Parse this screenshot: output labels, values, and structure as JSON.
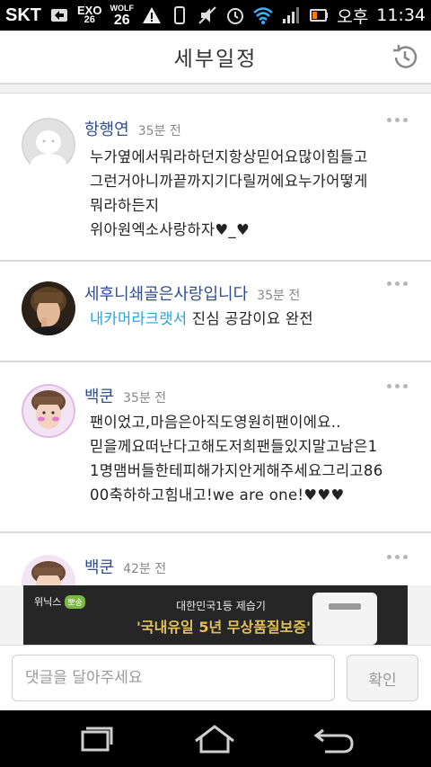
{
  "status_bar": {
    "carrier": "SKT",
    "exo_label": "EXO",
    "exo_num": "26",
    "wolf_label": "WOLF",
    "wolf_num": "26",
    "ampm": "오후",
    "time": "11:34"
  },
  "header": {
    "title": "세부일정",
    "history_icon": "history-icon"
  },
  "comments": [
    {
      "name": "항행연",
      "time": "35분 전",
      "lines": [
        "누가옆에서뭐라하던지항상믿어요많이힘들고",
        "그런거아니까끝까지기다릴꺼에요누가어떻게",
        "뭐라하든지",
        "위아원엑소사랑하자♥_♥"
      ]
    },
    {
      "name": "세후니쇄골은사랑입니다",
      "time": "35분 전",
      "mention": "내카머라크랫서",
      "text": " 진심 공감이요 완전"
    },
    {
      "name": "백쿤",
      "time": "35분 전",
      "lines": [
        "팬이었고,마음은아직도영원히팬이에요..",
        "믿을께요떠난다고해도저희팬들있지말고남은1",
        "1명맴버들한테피해가지안게해주세요그리고86",
        "00축하하고힘내고!we are one!♥♥♥"
      ]
    },
    {
      "name": "백쿤",
      "time": "42분 전"
    }
  ],
  "ad": {
    "brand": "위닉스",
    "badge": "뽀송",
    "line1": "대한민국1등 제습기",
    "line2": "'국내유일 5년 무상품질보증'"
  },
  "input": {
    "placeholder": "댓글을 달아주세요",
    "value": "",
    "confirm_label": "확인"
  },
  "colors": {
    "name": "#2f4d8f",
    "mention": "#2aa4d8",
    "ad_bg": "#262626",
    "ad_highlight": "#e2c15b"
  }
}
